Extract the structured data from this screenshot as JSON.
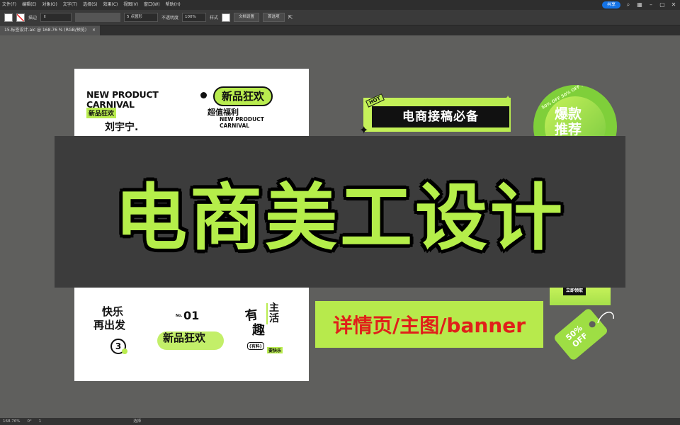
{
  "menu": [
    "文件(F)",
    "编辑(E)",
    "对象(O)",
    "文字(T)",
    "选择(S)",
    "效果(C)",
    "视图(V)",
    "窗口(W)",
    "帮助(H)"
  ],
  "share_label": "共享",
  "control": {
    "stroke_label": "描边",
    "point_label": "5 点圆形",
    "opacity_label": "不透明度",
    "opacity_value": "100%",
    "style_label": "样式",
    "doc_setup": "文档设置",
    "preferences": "首选项"
  },
  "doc_tab": "15.标签设计.aic @ 168.76 % (RGB/预览)",
  "status": {
    "zoom": "168.76%",
    "angle": "0°",
    "page": "1",
    "tool": "选择"
  },
  "art1": {
    "title_line1": "NEW PRODUCT",
    "title_line2": "CARNIVAL",
    "tag": "新品狂欢",
    "name": "刘宇宁.",
    "badge": "新品狂欢",
    "sub": "超值福利",
    "sub_en1": "NEW PRODUCT",
    "sub_en2": "CARNIVAL"
  },
  "art2": {
    "hot": "HOT",
    "text": "电商接稿必备",
    "circle_text": "爆款",
    "circle_text2": "推荐",
    "ring": "50% OFF 50% OFF 50% OFF"
  },
  "art3": {
    "happy1": "快乐",
    "happy2": "再出发",
    "num3": "3",
    "no": "No.",
    "num01": "01",
    "carnival": "新品狂欢",
    "you": "有",
    "qu": "趣",
    "zhu": "主",
    "huo": "活",
    "youliao": "(有料)",
    "yaokuaile": "要快乐"
  },
  "receive": "立即领取",
  "price_tag": "50% OFF",
  "main_title": "电商美工设计",
  "detail_banner": "详情页/主图/banner",
  "colors": {
    "accent_green": "#b5ee4a",
    "text_red": "#e0201a",
    "share_blue": "#1473e6"
  }
}
